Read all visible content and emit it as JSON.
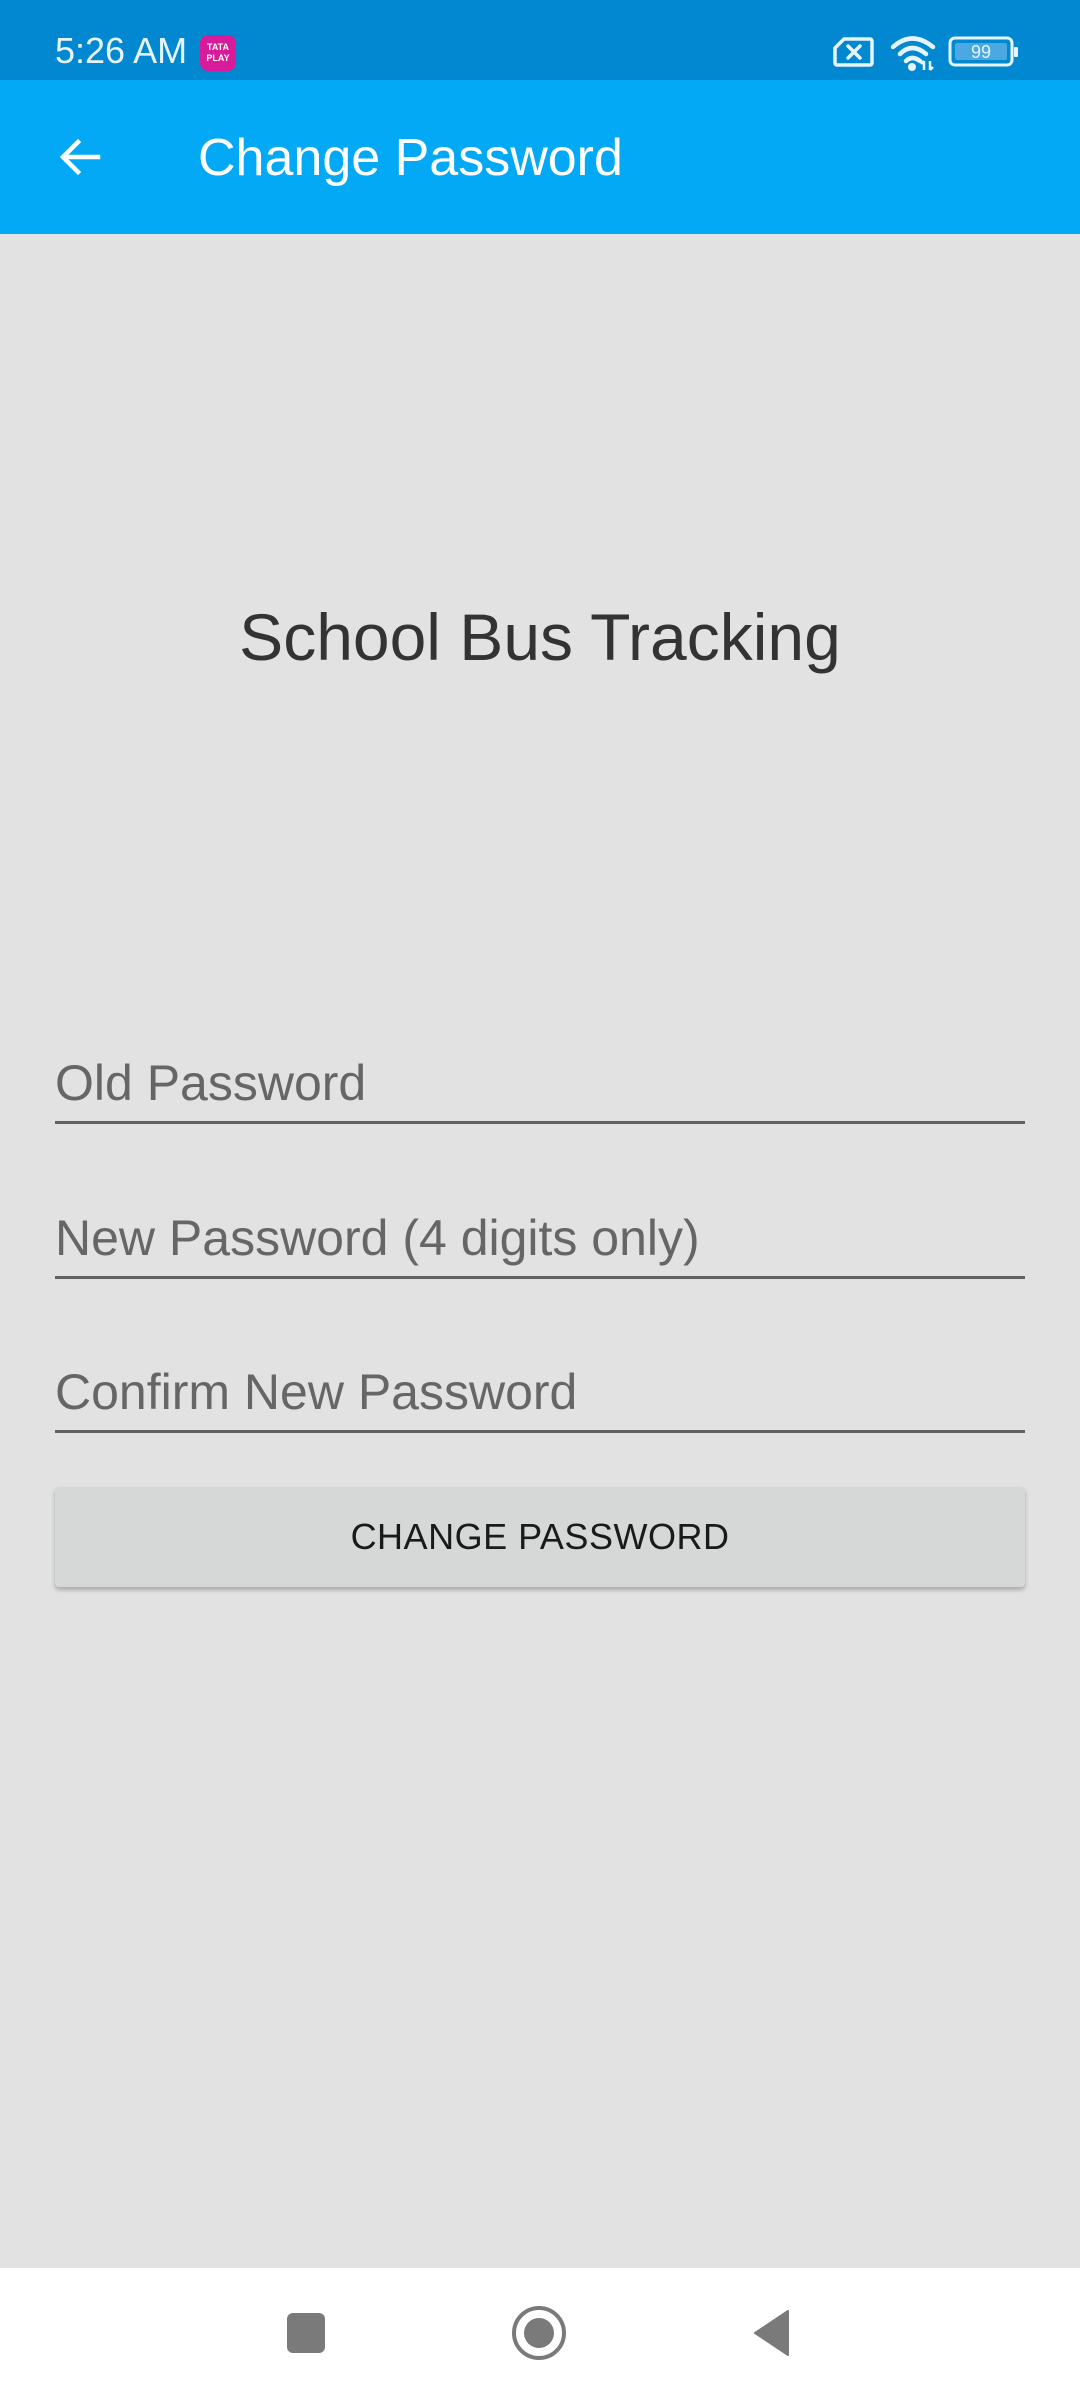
{
  "status_bar": {
    "time": "5:26 AM",
    "notification_badge": "TATA PLAY",
    "icons": [
      "sim-disabled-icon",
      "wifi-icon",
      "battery-icon"
    ],
    "battery_level": "99"
  },
  "app_bar": {
    "back_icon": "arrow-back-icon",
    "title": "Change Password",
    "color": "#03a9f4"
  },
  "main": {
    "app_name": "School Bus Tracking",
    "fields": {
      "old_password": {
        "placeholder": "Old Password",
        "value": ""
      },
      "new_password": {
        "placeholder": "New Password (4 digits only)",
        "value": ""
      },
      "confirm_password": {
        "placeholder": "Confirm New Password",
        "value": ""
      }
    },
    "submit_label": "CHANGE PASSWORD"
  },
  "nav_bar": {
    "items": [
      "recents-icon",
      "home-icon",
      "back-icon"
    ]
  }
}
